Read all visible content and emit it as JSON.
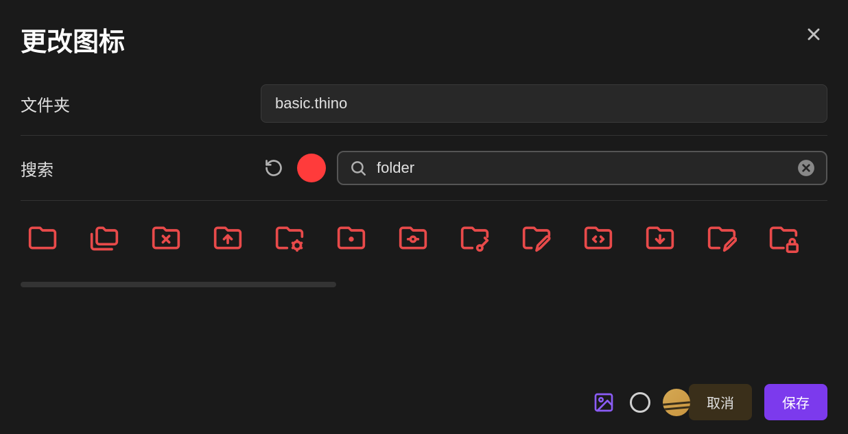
{
  "title": "更改图标",
  "folder": {
    "label": "文件夹",
    "value": "basic.thino"
  },
  "search": {
    "label": "搜索",
    "value": "folder",
    "accent_color": "#ff3b3b"
  },
  "icons": [
    "folder-icon",
    "folders-icon",
    "folder-x-icon",
    "folder-up-icon",
    "folder-cog-icon",
    "folder-dot-icon",
    "folder-git-icon",
    "folder-key-icon",
    "folder-pen-icon",
    "folder-code-icon",
    "folder-down-icon",
    "folder-edit-icon",
    "folder-lock-icon",
    "folder-open-icon"
  ],
  "footer": {
    "cancel_label": "取消",
    "save_label": "保存"
  }
}
